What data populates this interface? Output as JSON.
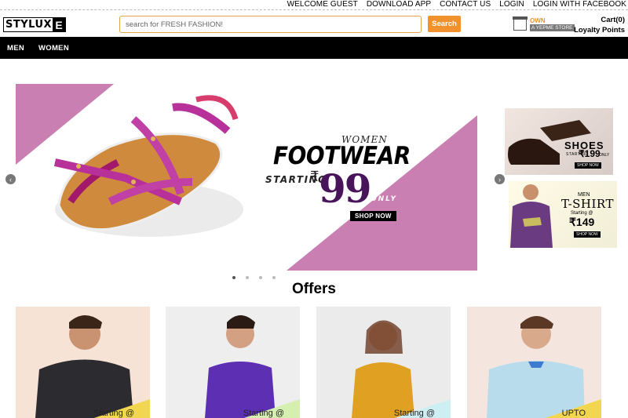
{
  "topbar": {
    "links": [
      "WELCOME GUEST",
      "DOWNLOAD APP",
      "CONTACT US",
      "LOGIN",
      "LOGIN WITH FACEBOOK"
    ]
  },
  "header": {
    "logo_text": "STYLUX",
    "logo_letter": "E",
    "search_placeholder": "search for FRESH FASHION!",
    "search_button": "Search",
    "store_own": "OWN",
    "store_name": "A YEPME STORE",
    "cart": "Cart(0)",
    "loyalty": "Loyalty Points"
  },
  "nav": {
    "items": [
      "MEN",
      "WOMEN"
    ]
  },
  "banner": {
    "women": "WOMEN",
    "title": "FOOTWEAR",
    "starting": "STARTING",
    "currency": "₹",
    "price": "99",
    "only": "ONLY",
    "cta": "SHOP NOW",
    "prev_arrow": "‹",
    "next_arrow": "›",
    "slide_count": 4,
    "active_slide": 1
  },
  "side_banners": [
    {
      "title": "SHOES",
      "starting": "STARTING",
      "currency": "₹",
      "price": "199",
      "only": "ONLY",
      "cta": "SHOP NOW"
    },
    {
      "label": "MEN",
      "title": "T-SHIRT",
      "starting": "Starting @",
      "currency": "₹",
      "price": "149",
      "cta": "SHOP NOW"
    }
  ],
  "offers": {
    "title": "Offers",
    "cards": [
      {
        "ribbon": "Starting @",
        "bg": "#f6e3d6",
        "ribbon_color": "#f2d64f"
      },
      {
        "ribbon": "Starting @",
        "bg": "#eeeeee",
        "ribbon_color": "#d5efb0"
      },
      {
        "ribbon": "Starting @",
        "bg": "#ebebeb",
        "ribbon_color": "#cdeff3"
      },
      {
        "ribbon": "UPTO",
        "bg": "#f4e6df",
        "ribbon_color": "#f2d64f"
      }
    ]
  },
  "colors": {
    "accent_orange": "#f0922e",
    "banner_pink": "#c97fb2",
    "price_purple": "#48145a"
  }
}
